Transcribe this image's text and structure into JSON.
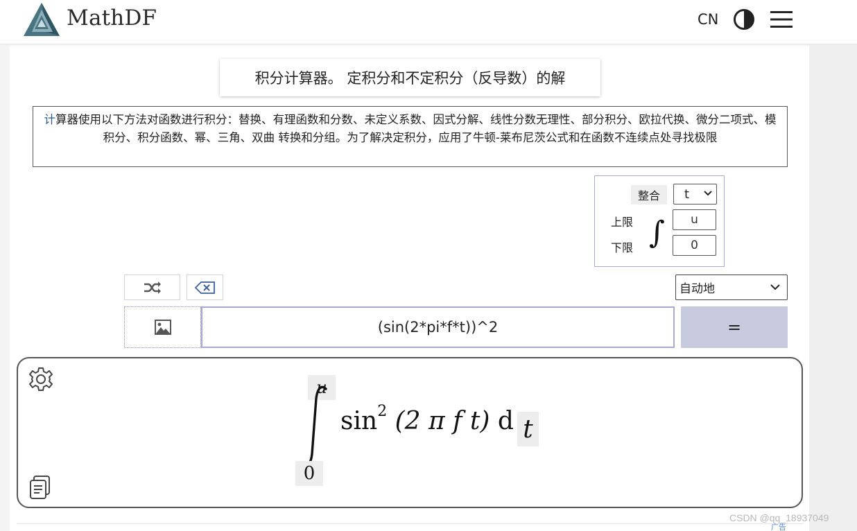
{
  "header": {
    "brand": "MathDF",
    "lang": "CN",
    "icons": [
      "logo-icon",
      "theme-toggle-icon",
      "menu-icon"
    ]
  },
  "title": "积分计算器。 定积分和不定积分（反导数）的解",
  "description": {
    "first_char": "计",
    "rest": "算器使用以下方法对函数进行积分：替换、有理函数和分数、未定义系数、因式分解、线性分数无理性、部分积分、欧拉代换、微分二项式、模积分、积分函数、幂、三角、双曲 转换和分组。为了解决定积分，应用了牛顿-莱布尼茨公式和在函数不连续点处寻找极限"
  },
  "integration": {
    "label": "整合",
    "variable": "t",
    "upper_label": "上限",
    "lower_label": "下限",
    "upper_value": "u",
    "lower_value": "0",
    "sign": "∫"
  },
  "toolbar": {
    "mode": "自动地",
    "icons": [
      "shuffle-icon",
      "clear-icon",
      "image-icon"
    ]
  },
  "input": {
    "expression": "(sin(2*pi*f*t))^2",
    "submit": "="
  },
  "result": {
    "upper": "u",
    "lower": "0",
    "func": "sin",
    "power": "2",
    "argument": "(2 π f t)",
    "differential": "d",
    "variable": "t"
  },
  "footer": {
    "ad": "广告",
    "watermark": "CSDN @qq_18937049"
  },
  "colors": {
    "panel_border": "#a9a9d6",
    "submit_bg": "#c8cadf",
    "logo_dark": "#3d6a7a",
    "logo_light": "#9bb8c2"
  }
}
